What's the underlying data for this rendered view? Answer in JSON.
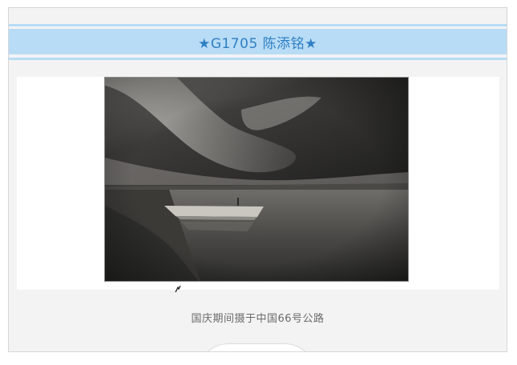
{
  "header": {
    "title": "★G1705 陈添铭★"
  },
  "photo": {
    "alt": "black-and-white lake landscape with a boat on the shore"
  },
  "caption": {
    "text": "国庆期间摄于中国66号公路"
  },
  "colors": {
    "banner_bg": "#b8dcf5",
    "banner_text": "#2f7fc4",
    "card_bg": "#f3f3f4",
    "caption_text": "#6a6a6a"
  }
}
